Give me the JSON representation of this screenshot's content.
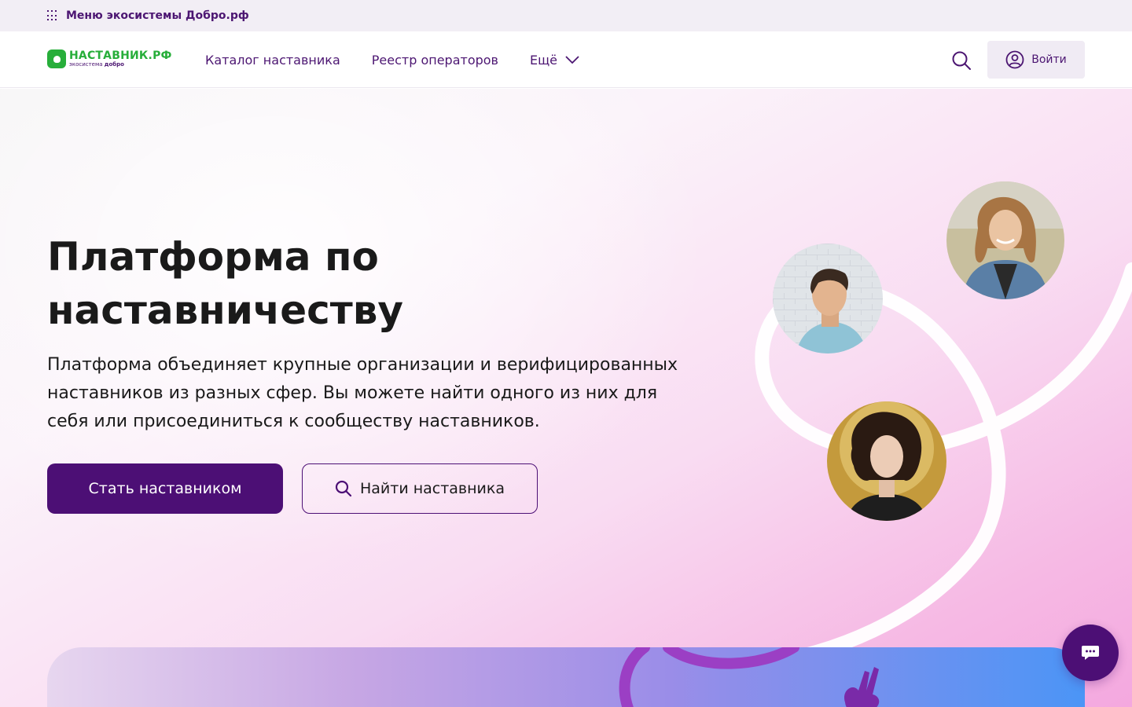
{
  "ecosystem_bar": {
    "label": "Меню экосистемы Добро.рф",
    "icon": "grid-icon"
  },
  "logo": {
    "main": "НАСТАВНИК.РФ",
    "sub_prefix": "экосистема",
    "sub_brand": "добро"
  },
  "nav": {
    "items": [
      {
        "label": "Каталог наставника"
      },
      {
        "label": "Реестр операторов"
      },
      {
        "label": "Ещё",
        "icon": "chevron-down-icon"
      }
    ]
  },
  "header": {
    "search_icon": "search-icon",
    "login_label": "Войти",
    "login_icon": "user-circle-icon"
  },
  "hero": {
    "title": "Платформа по наставничеству",
    "description": "Платформа объединяет крупные организации и верифицированных наставников из разных сфер. Вы можете найти одного из них для себя или присоединиться к сообществу наставников.",
    "primary_button": "Стать наставником",
    "secondary_button": "Найти наставника",
    "avatars": [
      "young-man-avatar",
      "smiling-woman-avatar",
      "curly-hair-woman-avatar"
    ]
  },
  "chat": {
    "icon": "chat-icon"
  },
  "colors": {
    "brand_purple": "#4c0f75",
    "brand_green": "#27ae3a",
    "hero_pink": "#f4a8df",
    "banner_blue": "#4b95f6"
  }
}
